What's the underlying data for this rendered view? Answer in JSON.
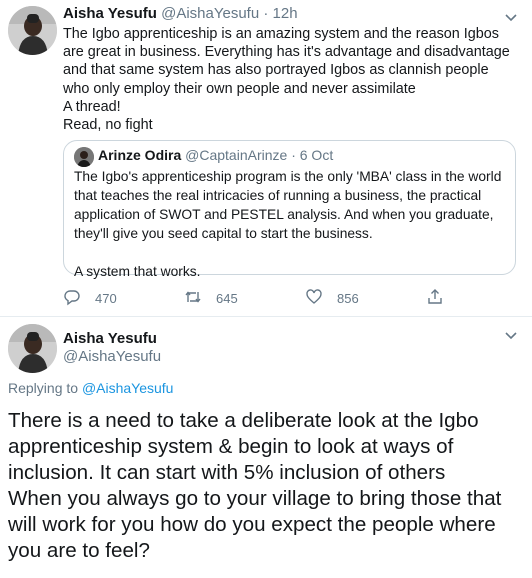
{
  "tweet1": {
    "name": "Aisha Yesufu",
    "handle": "@AishaYesufu",
    "separator": "·",
    "time": "12h",
    "text": "The Igbo apprenticeship is an amazing system and the reason Igbos are great in business. Everything has it's advantage and disadvantage and that same system has also portrayed Igbos as clannish people who only employ their own people and never assimilate\nA thread!\nRead, no fight",
    "quote": {
      "name": "Arinze Odira",
      "handle": "@CaptainArinze",
      "separator": "·",
      "time": "6 Oct",
      "text": "The Igbo's apprenticeship program is the only 'MBA' class in the world that teaches the real intricacies of running a business, the practical application of SWOT and PESTEL analysis. And when you graduate, they'll give you seed capital to start the business.\n\nA system that works."
    },
    "actions": {
      "reply_count": "470",
      "retweet_count": "645",
      "like_count": "856"
    }
  },
  "tweet2": {
    "name": "Aisha Yesufu",
    "handle": "@AishaYesufu",
    "replying_prefix": "Replying to",
    "replying_handle": "@AishaYesufu",
    "text": "There is a need to take a deliberate look at the Igbo apprenticeship system & begin to look at ways of inclusion. It can start with 5% inclusion of others\nWhen you always go to your village to bring those that will work for you how do you expect the people where you are to feel?"
  },
  "colors": {
    "link": "#1b95e0",
    "muted": "#657786",
    "border": "#ccd6dd"
  },
  "icons": [
    "reply-icon",
    "retweet-icon",
    "like-icon",
    "share-icon",
    "chevron-down-icon"
  ]
}
